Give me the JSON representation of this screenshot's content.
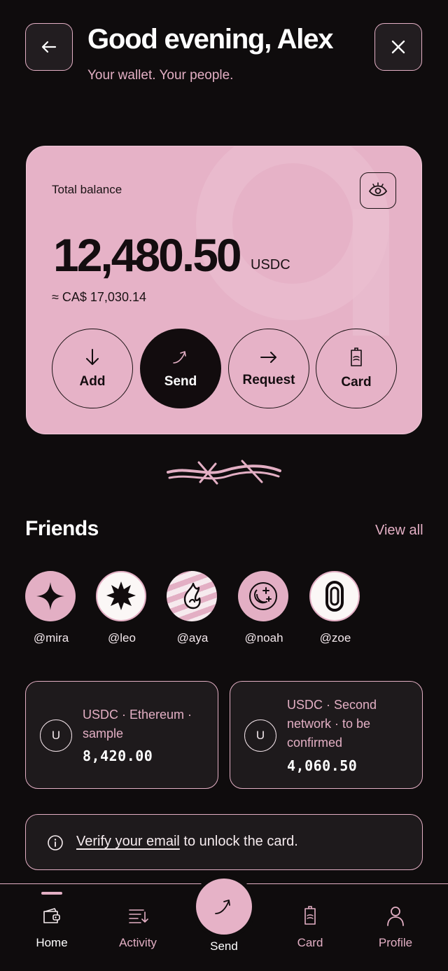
{
  "header": {
    "greeting": "Good evening, Alex",
    "tagline": "Your wallet. Your people."
  },
  "balance": {
    "label": "Total balance",
    "amount": "12,480.50",
    "unit": "USDC",
    "fiat": "≈ CA$ 17,030.14",
    "actions": [
      {
        "label": "Add",
        "icon": "arrow-down-icon"
      },
      {
        "label": "Send",
        "icon": "send-arrow-icon"
      },
      {
        "label": "Request",
        "icon": "arrow-right-icon"
      },
      {
        "label": "Card",
        "icon": "card-icon"
      }
    ]
  },
  "friends": {
    "title": "Friends",
    "view_all": "View all",
    "items": [
      {
        "handle": "@mira",
        "icon": "sparkle-icon"
      },
      {
        "handle": "@leo",
        "icon": "starburst-icon"
      },
      {
        "handle": "@aya",
        "icon": "flame-icon"
      },
      {
        "handle": "@noah",
        "icon": "moon-stars-icon"
      },
      {
        "handle": "@zoe",
        "icon": "loop-icon"
      }
    ]
  },
  "wallets": [
    {
      "badge": "U",
      "title": "USDC · Ethereum · sample",
      "amount": "8,420.00"
    },
    {
      "badge": "U",
      "title": "USDC · Second network · to be confirmed",
      "amount": "4,060.50"
    }
  ],
  "notice": {
    "link": "Verify your email",
    "text": " to unlock the card."
  },
  "tabbar": {
    "items": [
      {
        "label": "Home",
        "icon": "wallet-icon",
        "active": true
      },
      {
        "label": "Activity",
        "icon": "activity-list-icon"
      },
      {
        "label": "Send",
        "icon": "send-arrow-icon"
      },
      {
        "label": "Card",
        "icon": "card-icon"
      },
      {
        "label": "Profile",
        "icon": "person-icon"
      }
    ]
  },
  "colors": {
    "accent": "#e3afc4",
    "background": "#0f0c0d",
    "card": "#1e1a1c"
  }
}
